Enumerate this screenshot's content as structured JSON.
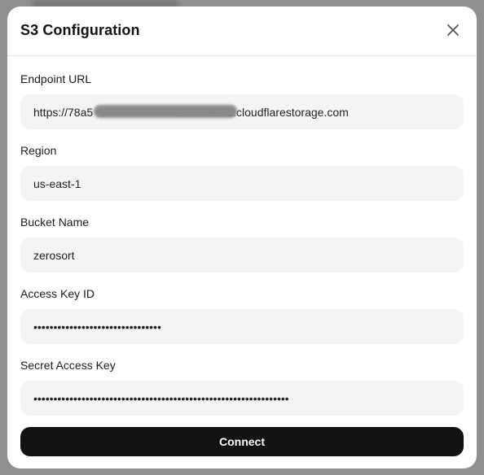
{
  "dialog": {
    "title": "S3 Configuration",
    "close_icon": "close-icon"
  },
  "fields": {
    "endpoint": {
      "label": "Endpoint URL",
      "value": "https://78a5                          58e772e.r2.cloudflarestorage.com"
    },
    "region": {
      "label": "Region",
      "value": "us-east-1"
    },
    "bucket": {
      "label": "Bucket Name",
      "value": "zerosort"
    },
    "access_key": {
      "label": "Access Key ID",
      "value": "••••••••••••••••••••••••••••••••"
    },
    "secret_key": {
      "label": "Secret Access Key",
      "value": "••••••••••••••••••••••••••••••••••••••••••••••••••••••••••••••••"
    }
  },
  "actions": {
    "connect_label": "Connect"
  },
  "colors": {
    "primary_button": "#121212",
    "input_bg": "#f4f4f4"
  }
}
